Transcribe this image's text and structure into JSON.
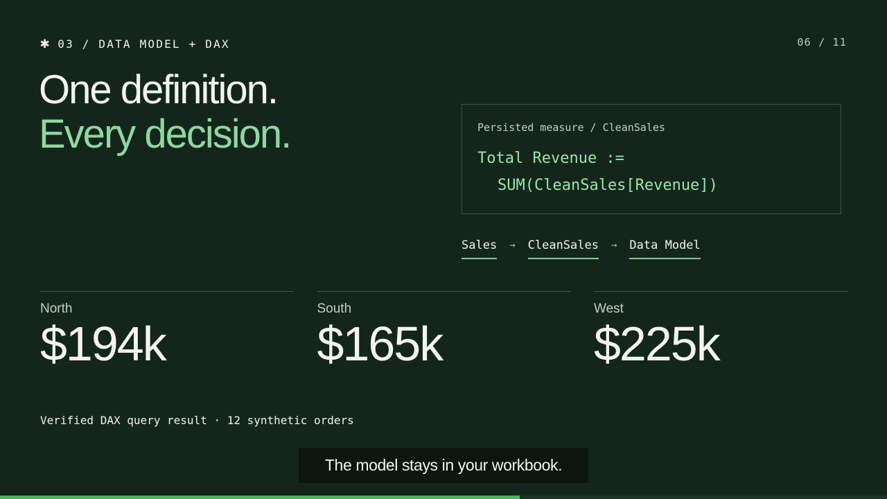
{
  "header": {
    "section_marker": "✱",
    "section_label": "03 / DATA MODEL + DAX",
    "page_counter": "06 / 11"
  },
  "headline": {
    "line1": "One definition.",
    "line2": "Every decision."
  },
  "code_card": {
    "caption": "Persisted measure / CleanSales",
    "line1": "Total Revenue :=",
    "line2": "SUM(CleanSales[Revenue])"
  },
  "lineage": {
    "steps": [
      "Sales",
      "CleanSales",
      "Data Model"
    ],
    "arrow": "→"
  },
  "metrics": [
    {
      "region": "North",
      "value": "$194k"
    },
    {
      "region": "South",
      "value": "$165k"
    },
    {
      "region": "West",
      "value": "$225k"
    }
  ],
  "footnote": "Verified DAX query result · 12 synthetic orders",
  "subtitle": "The model stays in your workbook.",
  "progress": {
    "fraction": 0.586
  },
  "colors": {
    "background": "#14261b",
    "accent": "#8fd8a1",
    "progress": "#4caf61"
  }
}
